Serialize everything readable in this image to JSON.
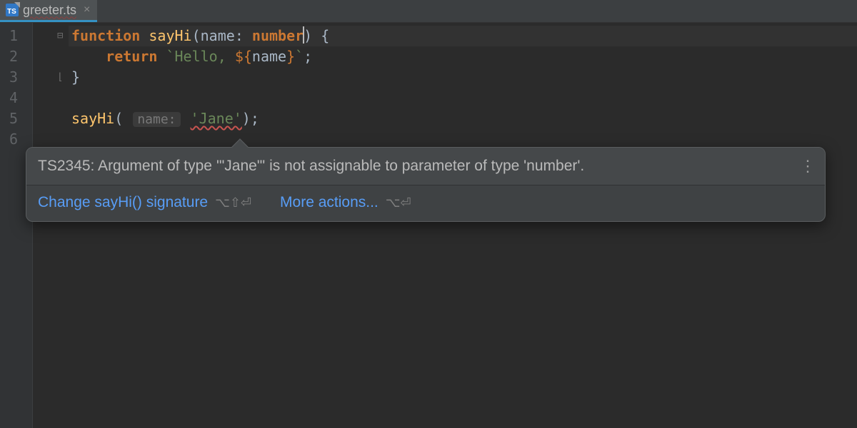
{
  "tab": {
    "filename": "greeter.ts",
    "icon_label": "TS"
  },
  "gutter": {
    "lines": [
      "1",
      "2",
      "3",
      "4",
      "5",
      "6"
    ]
  },
  "code": {
    "l1": {
      "kw": "function",
      "fn": "sayHi",
      "p1": "(",
      "param": "name",
      "colon": ": ",
      "type": "number",
      "p2": ") {"
    },
    "l2": {
      "kw": "return",
      "btick1": "`",
      "txt": "Hello, ",
      "open": "${",
      "var": "name",
      "close": "}",
      "btick2": "`",
      "semi": ";"
    },
    "l3": {
      "brace": "}"
    },
    "l5": {
      "call": "sayHi",
      "open": "(",
      "hint": "name:",
      "arg": "'Jane'",
      "close": ");"
    }
  },
  "tooltip": {
    "message": "TS2345: Argument of type '\"Jane\"' is not assignable to parameter of type 'number'.",
    "action1": "Change sayHi() signature",
    "shortcut1": "⌥⇧⏎",
    "action2": "More actions...",
    "shortcut2": "⌥⏎"
  }
}
